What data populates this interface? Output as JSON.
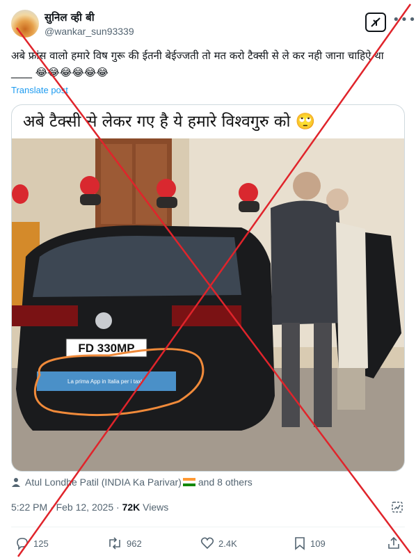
{
  "author": {
    "name": "सुनिल व्ही बी",
    "handle": "@wankar_sun93339"
  },
  "tweet": {
    "text": "अबे फ्रांस वालो हमारे विष गुरू की ईतनी बेईज्जती तो मत करो टैक्सी से ले कर नही जाना चाहिऐ था ____ 😂😂😂😂😂😂",
    "translate_label": "Translate post"
  },
  "media": {
    "caption": "अबे टैक्सी से लेकर गए है ये हमारे विश्वगुरु को 🙄",
    "license_plate": "FD 330MP",
    "ad_banner_text": "La prima App in Italia per i taxi"
  },
  "tagged": {
    "first_person": "Atul Londhe Patil (INDIA Ka Parivar)",
    "others": "and 8 others"
  },
  "meta": {
    "time": "5:22 PM",
    "separator": "·",
    "date": "Feb 12, 2025",
    "views_count": "72K",
    "views_label": "Views"
  },
  "actions": {
    "replies": "125",
    "reposts": "962",
    "likes": "2.4K",
    "bookmarks": "109"
  },
  "colors": {
    "accent": "#1d9bf0",
    "secondary_text": "#536471",
    "cross_overlay": "#e0242b",
    "circle_annotation": "#f08a3a"
  },
  "icons": [
    "grok-icon",
    "more-icon",
    "person-icon",
    "flag-india-icon",
    "analytics-icon",
    "reply-icon",
    "repost-icon",
    "like-icon",
    "bookmark-icon",
    "share-icon"
  ]
}
